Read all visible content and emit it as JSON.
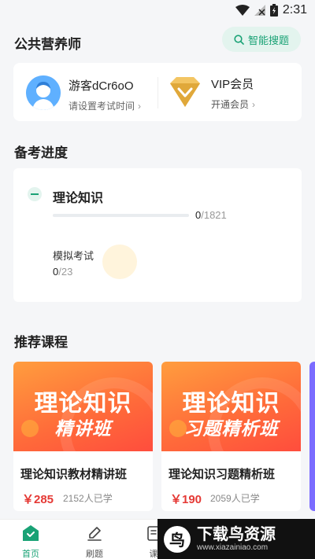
{
  "status_bar": {
    "time": "2:31"
  },
  "header": {
    "title": "公共营养师",
    "search_label": "智能搜题"
  },
  "user": {
    "name": "游客dCr6oO",
    "subtitle": "请设置考试时间"
  },
  "vip": {
    "title": "VIP会员",
    "subtitle": "开通会员"
  },
  "progress_section": {
    "title": "备考进度",
    "theory": {
      "label": "理论知识",
      "done": "0",
      "total": "/1821",
      "progress": 0
    },
    "mock": {
      "label": "模拟考试",
      "done": "0",
      "total": "/23"
    }
  },
  "courses_section": {
    "title": "推荐课程",
    "courses": [
      {
        "banner_line1": "理论知识",
        "banner_line2": "精讲班",
        "name": "理论知识教材精讲班",
        "price": "￥285",
        "learners": "2152人已学"
      },
      {
        "banner_line1": "理论知识",
        "banner_line2": "习题精析班",
        "name": "理论知识习题精析班",
        "price": "￥190",
        "learners": "2059人已学"
      }
    ]
  },
  "tabbar": {
    "tabs": [
      {
        "label": "首页"
      },
      {
        "label": "刷题"
      },
      {
        "label": "课"
      }
    ]
  },
  "watermark": {
    "title": "下载鸟资源",
    "url": "www.xiazainiao.com",
    "logo_text": "鸟"
  },
  "colors": {
    "accent": "#19a275",
    "price": "#e53935",
    "vip_gold": "#e0a83a"
  }
}
